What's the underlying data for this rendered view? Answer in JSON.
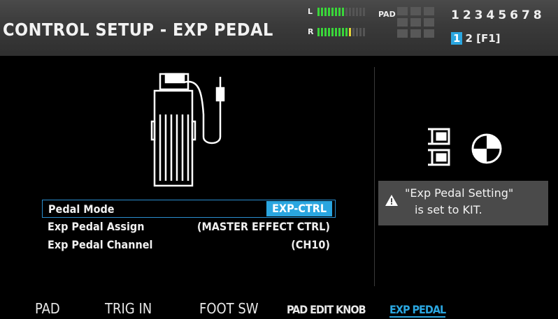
{
  "header": {
    "title": "CONTROL SETUP - EXP PEDAL",
    "meter_l_label": "L",
    "meter_r_label": "R",
    "meter_l_level": 0.6,
    "meter_r_level": 0.68,
    "pad_label": "PAD",
    "channel_numbers": "12345678",
    "selected_channel": "1",
    "page_info": "2 [F1]"
  },
  "params": [
    {
      "label": "Pedal Mode",
      "value": "EXP-CTRL",
      "selected": true
    },
    {
      "label": "Exp Pedal Assign",
      "value": "(MASTER EFFECT CTRL)",
      "selected": false
    },
    {
      "label": "Exp Pedal Channel",
      "value": "(CH10)",
      "selected": false
    }
  ],
  "notice": {
    "line1": "\"Exp Pedal Setting\"",
    "line2": "is set to KIT."
  },
  "icons": {
    "pedal": "expression-pedal-icon",
    "kit": "kit-icon",
    "color_accent": "#2aa6e0"
  },
  "tabs": [
    {
      "label": "PAD",
      "active": false
    },
    {
      "label": "TRIG IN",
      "active": false
    },
    {
      "label": "FOOT SW",
      "active": false
    },
    {
      "label": "PAD EDIT KNOB",
      "active": false
    },
    {
      "label": "EXP PEDAL",
      "active": true
    }
  ]
}
